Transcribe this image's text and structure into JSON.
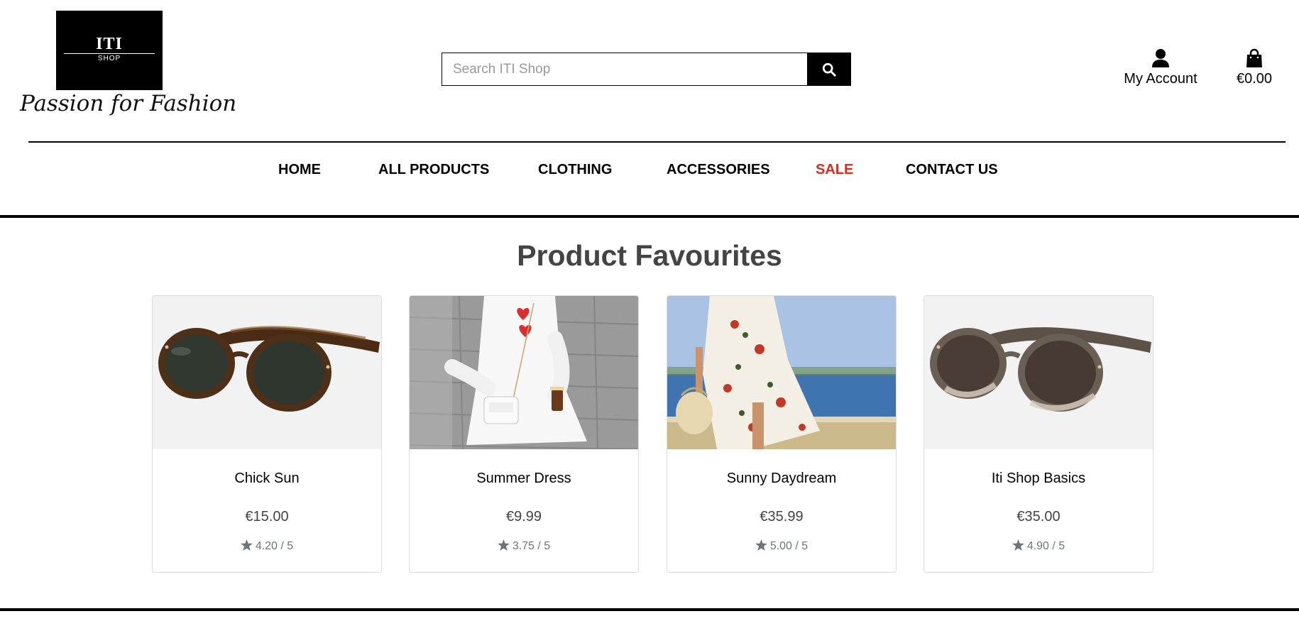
{
  "brand": {
    "logo_main": "ITI",
    "logo_sub": "SHOP",
    "tagline": "Passion for Fashion"
  },
  "search": {
    "placeholder": "Search ITI Shop",
    "value": "",
    "icon": "search-icon"
  },
  "account": {
    "label": "My Account",
    "icon": "user-icon"
  },
  "bag": {
    "total": "€0.00",
    "icon": "shopping-bag-icon"
  },
  "nav": {
    "items": [
      {
        "label": "HOME"
      },
      {
        "label": "ALL PRODUCTS"
      },
      {
        "label": "CLOTHING"
      },
      {
        "label": "ACCESSORIES"
      },
      {
        "label": "SALE",
        "color": "#d32f1e"
      },
      {
        "label": "CONTACT US"
      }
    ]
  },
  "section": {
    "title": "Product Favourites"
  },
  "products": [
    {
      "name": "Chick Sun",
      "price": "€15.00",
      "rating": "4.20 / 5",
      "image": "tortoiseshell-sunglasses"
    },
    {
      "name": "Summer Dress",
      "price": "€9.99",
      "rating": "3.75 / 5",
      "image": "white-summer-dress"
    },
    {
      "name": "Sunny Daydream",
      "price": "€35.99",
      "rating": "5.00 / 5",
      "image": "floral-wrap-dress"
    },
    {
      "name": "Iti Shop Basics",
      "price": "€35.00",
      "rating": "4.90 / 5",
      "image": "brown-sunglasses"
    }
  ],
  "colors": {
    "sale": "#d32f1e",
    "rating_star": "#6c757d",
    "price": "#444444"
  }
}
